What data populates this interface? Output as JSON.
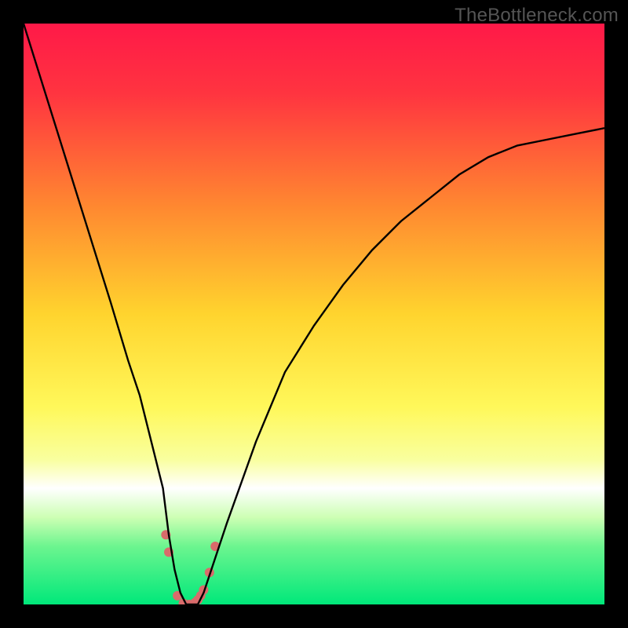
{
  "watermark": "TheBottleneck.com",
  "chart_data": {
    "type": "line",
    "title": "",
    "xlabel": "",
    "ylabel": "",
    "xlim": [
      0,
      100
    ],
    "ylim": [
      0,
      100
    ],
    "background": {
      "type": "vertical-gradient",
      "stops": [
        {
          "offset": 0,
          "color": "#ff1948"
        },
        {
          "offset": 0.12,
          "color": "#ff3440"
        },
        {
          "offset": 0.32,
          "color": "#ff8a30"
        },
        {
          "offset": 0.5,
          "color": "#ffd42e"
        },
        {
          "offset": 0.66,
          "color": "#fff85a"
        },
        {
          "offset": 0.75,
          "color": "#f9ff9e"
        },
        {
          "offset": 0.8,
          "color": "#ffffff"
        },
        {
          "offset": 0.85,
          "color": "#cdffb4"
        },
        {
          "offset": 0.9,
          "color": "#6cf58f"
        },
        {
          "offset": 1.0,
          "color": "#00e87a"
        }
      ]
    },
    "series": [
      {
        "name": "bottleneck-curve",
        "color": "#000000",
        "x": [
          0,
          5,
          10,
          15,
          18,
          20,
          22,
          24,
          25,
          26,
          27,
          28,
          29,
          30,
          31,
          32,
          35,
          40,
          45,
          50,
          55,
          60,
          65,
          70,
          75,
          80,
          85,
          90,
          95,
          100
        ],
        "y": [
          100,
          84,
          68,
          52,
          42,
          36,
          28,
          20,
          12,
          6,
          2,
          0,
          0,
          0,
          2,
          5,
          14,
          28,
          40,
          48,
          55,
          61,
          66,
          70,
          74,
          77,
          79,
          80,
          81,
          82
        ]
      }
    ],
    "markers": {
      "name": "highlight-points",
      "color": "#d96b6b",
      "radius": 6,
      "points": [
        {
          "x": 24.5,
          "y": 12
        },
        {
          "x": 25.0,
          "y": 9
        },
        {
          "x": 26.5,
          "y": 1.5
        },
        {
          "x": 27.5,
          "y": 0.2
        },
        {
          "x": 28.5,
          "y": 0
        },
        {
          "x": 29.5,
          "y": 0.3
        },
        {
          "x": 30.0,
          "y": 0.8
        },
        {
          "x": 30.5,
          "y": 1.5
        },
        {
          "x": 31.0,
          "y": 2.5
        },
        {
          "x": 32.0,
          "y": 5.5
        },
        {
          "x": 33.0,
          "y": 10
        }
      ]
    }
  }
}
